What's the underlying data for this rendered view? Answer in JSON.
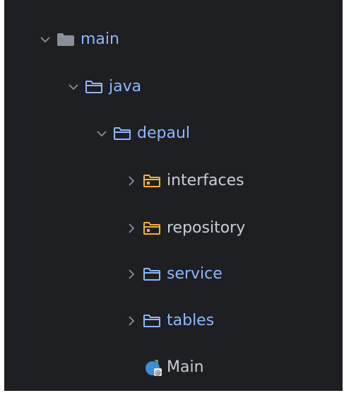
{
  "tree": {
    "items": [
      {
        "label": "main",
        "expanded": true,
        "icon": "folder-filled-icon"
      },
      {
        "label": "java",
        "expanded": true,
        "icon": "folder-outline-icon"
      },
      {
        "label": "depaul",
        "expanded": true,
        "icon": "folder-outline-icon"
      },
      {
        "label": "interfaces",
        "expanded": false,
        "icon": "package-folder-icon"
      },
      {
        "label": "repository",
        "expanded": false,
        "icon": "package-folder-icon"
      },
      {
        "label": "service",
        "expanded": false,
        "icon": "folder-outline-icon"
      },
      {
        "label": "tables",
        "expanded": false,
        "icon": "folder-outline-icon"
      },
      {
        "label": "Main",
        "icon": "java-class-icon"
      }
    ]
  },
  "colors": {
    "background": "#1e1f22",
    "folder_blue": "#8fb7ff",
    "folder_gray": "#8a9099",
    "package_yellow": "#f0b33b",
    "chevron": "#8a9099",
    "text_light": "#c9cdd4"
  }
}
